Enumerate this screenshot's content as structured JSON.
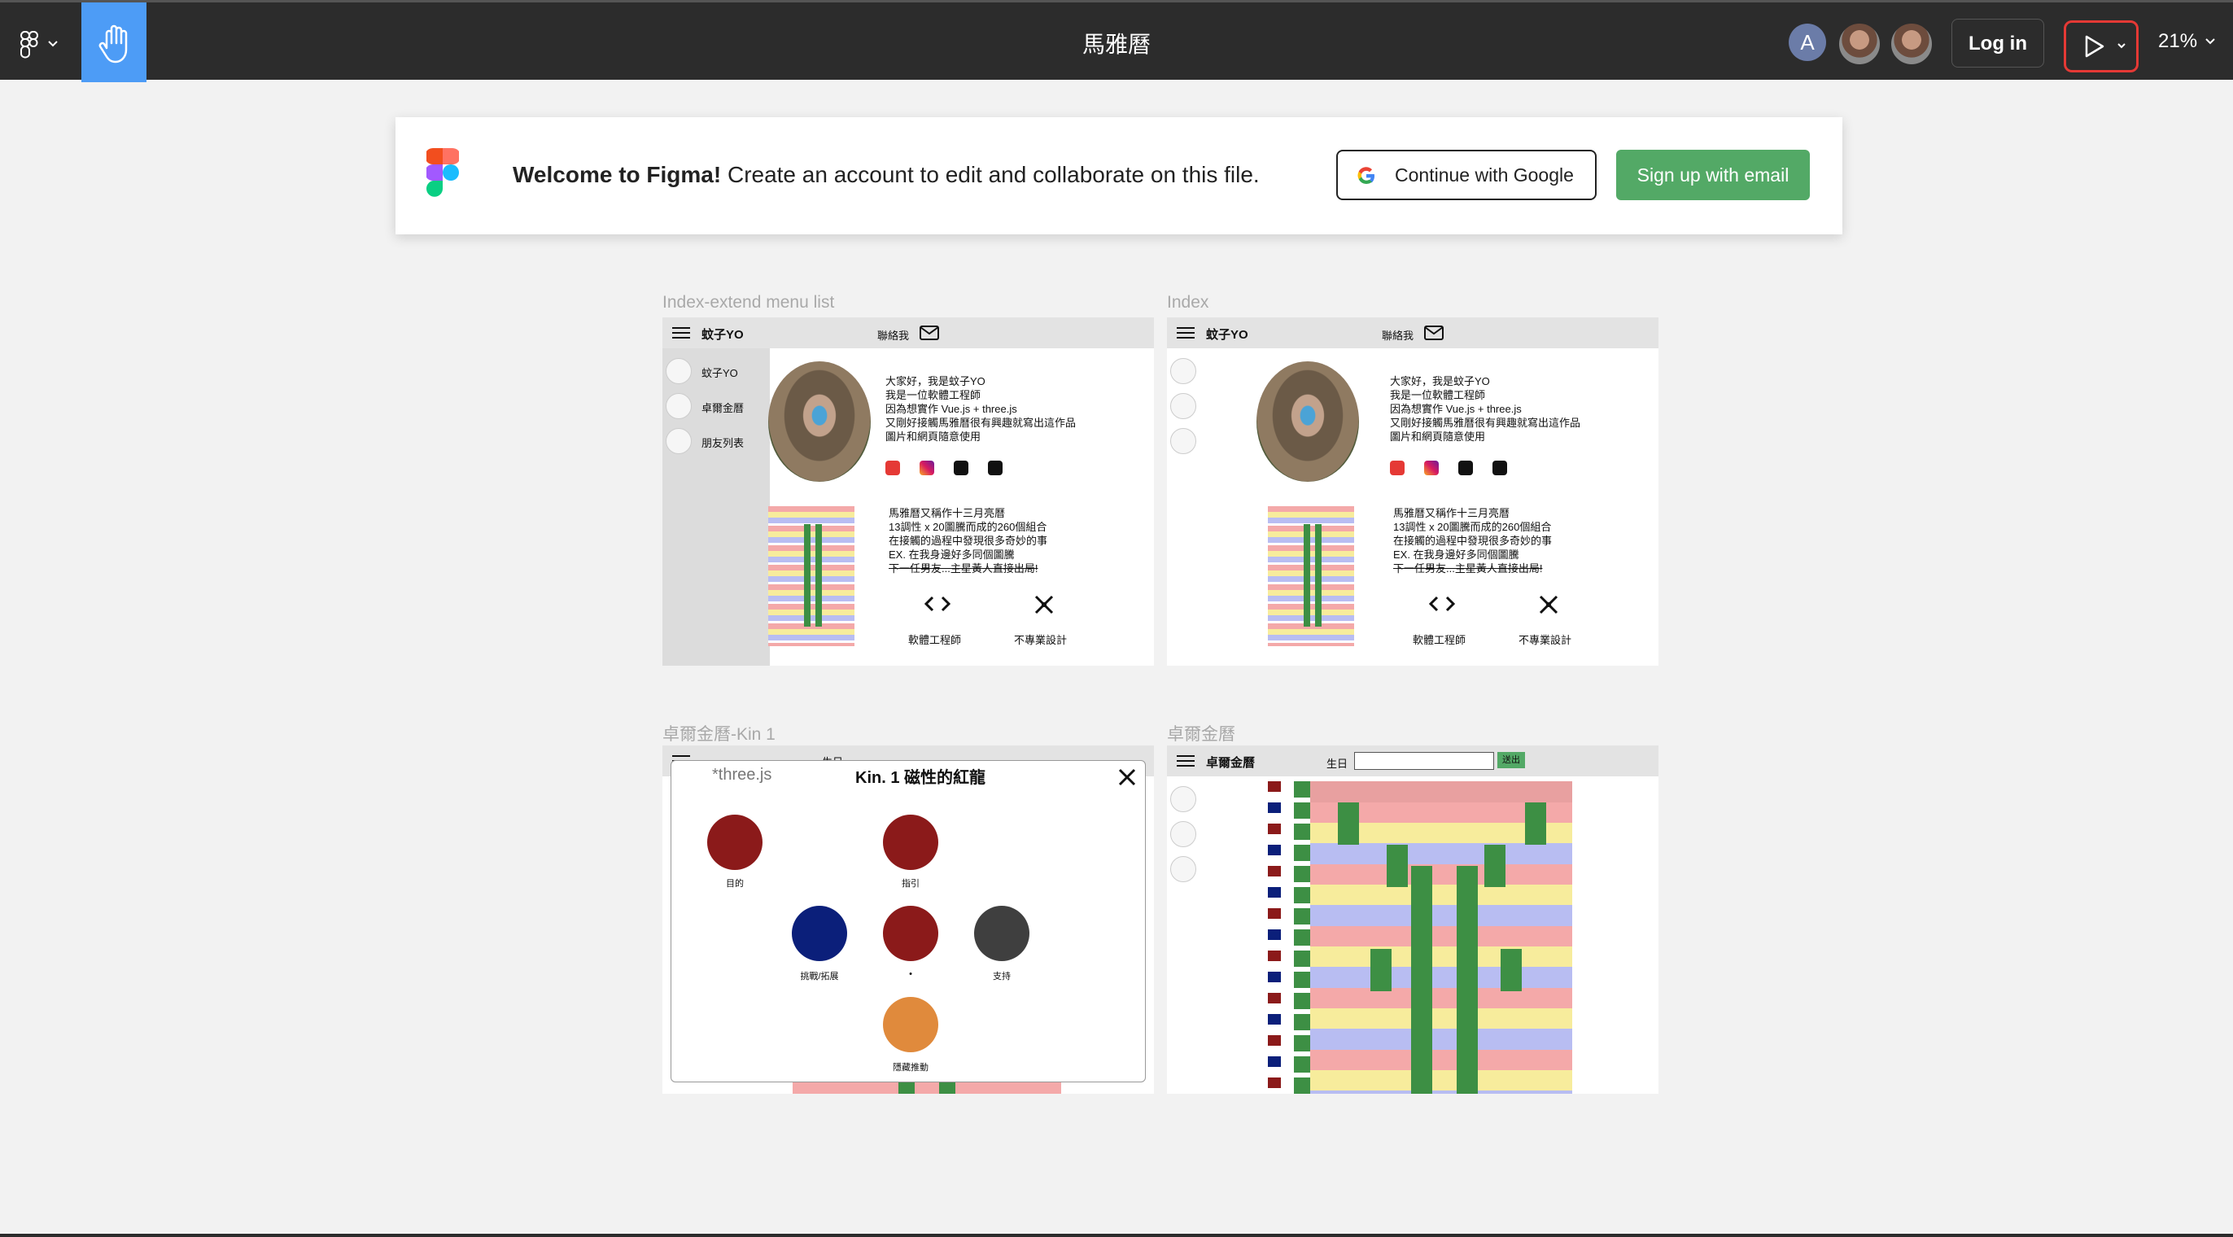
{
  "topbar": {
    "file_title": "馬雅曆",
    "avatar_initial": "A",
    "login_label": "Log in",
    "zoom_level": "21%"
  },
  "banner": {
    "welcome_bold": "Welcome to Figma!",
    "welcome_rest": " Create an account to edit and collaborate on this file.",
    "google_label": "Continue with Google",
    "email_label": "Sign up with email"
  },
  "frames": {
    "f1_label": "Index-extend menu list",
    "f2_label": "Index",
    "f3_label": "卓爾金曆-Kin 1",
    "f4_label": "卓爾金曆"
  },
  "site": {
    "brand": "蚊子YO",
    "contact": "聯絡我",
    "menu_items": [
      "蚊子YO",
      "卓爾金曆",
      "朋友列表"
    ],
    "intro": "大家好，我是蚊子YO\n我是一位軟體工程師\n因為想實作 Vue.js + three.js\n又剛好接觸馬雅曆很有興趣就寫出這作品\n圖片和網頁隨意使用",
    "about": "馬雅曆又稱作十三月亮曆\n13調性 x 20圖騰而成的260個組合\n在接觸的過程中發現很多奇妙的事\nEX. 在我身邊好多同個圖騰",
    "about_strike": "下一任男友...主星黃人直接出局!",
    "skill1": "軟體工程師",
    "skill2": "不專業設計",
    "calendar_title": "卓爾金曆",
    "birthday_label": "生日",
    "submit": "送出"
  },
  "modal": {
    "tab_label": "*three.js",
    "title": "Kin. 1 磁性的紅龍",
    "glyph_labels": [
      "目的",
      "指引",
      "挑戰/拓展",
      "•",
      "支持",
      "隱藏推動"
    ]
  },
  "colors": {
    "accent_blue": "#4d9cf6",
    "signup_green": "#53a966",
    "play_highlight": "#e53935",
    "glyph_red": "#8b1a1a",
    "glyph_navy": "#0b1f7a",
    "glyph_gray": "#3f3f3f",
    "glyph_orange": "#e08a3c",
    "calendar_green": "#3d8f44"
  }
}
